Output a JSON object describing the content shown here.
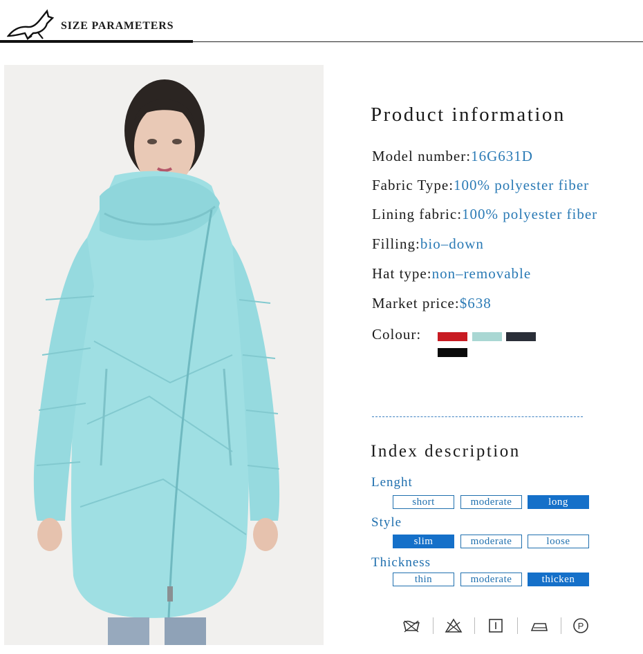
{
  "header": {
    "title": "SIZE PARAMETERS",
    "logo_icon": "running-fox-logo"
  },
  "product": {
    "title": "Product information",
    "rows": [
      {
        "label": "Model number:",
        "value": "16G631D"
      },
      {
        "label": "Fabric Type:",
        "value": "100% polyester fiber"
      },
      {
        "label": "Lining fabric:",
        "value": "100% polyester fiber"
      },
      {
        "label": "Filling:",
        "value": "bio–down"
      },
      {
        "label": "Hat type:",
        "value": "non–removable"
      },
      {
        "label": "Market price:",
        "value": "$638"
      }
    ],
    "colour_label": "Colour:",
    "colours": [
      "#c81b22",
      "#a9d7d3",
      "#2a2e38",
      "#0a0a0a"
    ]
  },
  "index": {
    "title": "Index description",
    "groups": [
      {
        "label": "Lenght",
        "options": [
          "short",
          "moderate",
          "long"
        ],
        "selected": "long"
      },
      {
        "label": "Style",
        "options": [
          "slim",
          "moderate",
          "loose"
        ],
        "selected": "slim"
      },
      {
        "label": "Thickness",
        "options": [
          "thin",
          "moderate",
          "thicken"
        ],
        "selected": "thicken"
      }
    ]
  },
  "care_icons": [
    "no-wash-icon",
    "no-bleach-icon",
    "tumble-dry-icon",
    "iron-icon",
    "dry-clean-p-icon"
  ],
  "colors": {
    "accent": "#1f6fae",
    "selected": "#1570c9",
    "coat": "#9fdfe3"
  }
}
